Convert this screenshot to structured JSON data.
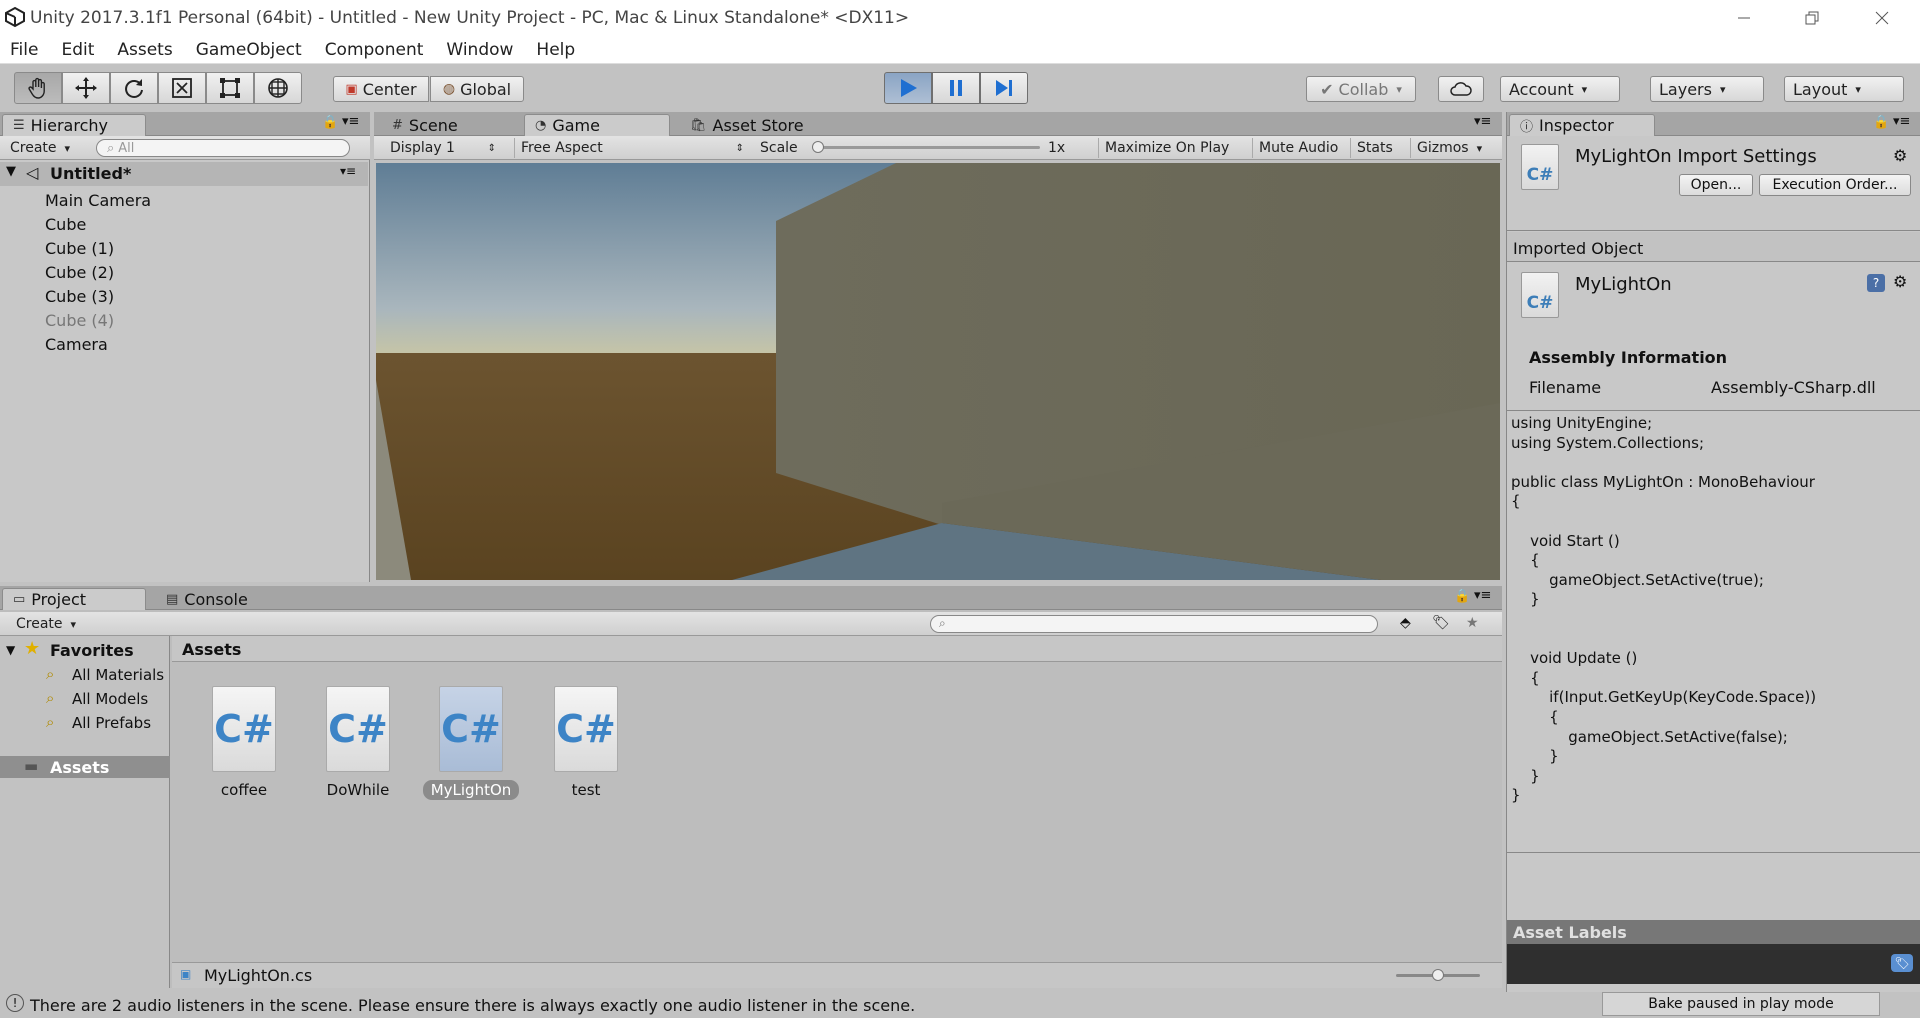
{
  "window": {
    "title": "Unity 2017.3.1f1 Personal (64bit) - Untitled - New Unity Project - PC, Mac & Linux Standalone* <DX11>"
  },
  "menu": [
    "File",
    "Edit",
    "Assets",
    "GameObject",
    "Component",
    "Window",
    "Help"
  ],
  "toolbar": {
    "pivot": "Center",
    "space": "Global",
    "collab": "Collab",
    "account": "Account",
    "layers": "Layers",
    "layout": "Layout"
  },
  "hierarchy": {
    "tab": "Hierarchy",
    "create": "Create",
    "search_placeholder": "All",
    "scene": "Untitled*",
    "items": [
      "Main Camera",
      "Cube",
      "Cube (1)",
      "Cube (2)",
      "Cube (3)",
      "Cube (4)",
      "Camera"
    ]
  },
  "center_tabs": [
    "Scene",
    "Game",
    "Asset Store"
  ],
  "game": {
    "display": "Display 1",
    "aspect": "Free Aspect",
    "scale_label": "Scale",
    "scale_value": "1x",
    "scale_fraction": 0,
    "maximize": "Maximize On Play",
    "mute": "Mute Audio",
    "stats": "Stats",
    "gizmos": "Gizmos"
  },
  "inspector": {
    "tab": "Inspector",
    "title": "MyLightOn Import Settings",
    "open_btn": "Open...",
    "exec_btn": "Execution Order...",
    "imported_object": "Imported Object",
    "object_name": "MyLightOn",
    "assembly_heading": "Assembly Information",
    "filename_label": "Filename",
    "filename_value": "Assembly-CSharp.dll",
    "code": "using UnityEngine;\nusing System.Collections;\n\npublic class MyLightOn : MonoBehaviour\n{\n\n    void Start ()\n    {\n        gameObject.SetActive(true);\n    }\n\n\n    void Update ()\n    {\n        if(Input.GetKeyUp(KeyCode.Space))\n        {\n            gameObject.SetActive(false);\n        }\n    }\n}",
    "asset_labels": "Asset Labels"
  },
  "project": {
    "tabs": [
      "Project",
      "Console"
    ],
    "create": "Create",
    "favorites": "Favorites",
    "favorites_items": [
      "All Materials",
      "All Models",
      "All Prefabs"
    ],
    "assets_root": "Assets",
    "breadcrumb": "Assets",
    "assets": [
      "coffee",
      "DoWhile",
      "MyLightOn",
      "test"
    ],
    "selected_asset": "MyLightOn",
    "selected_file": "MyLightOn.cs",
    "icon_size_fraction": 0.5
  },
  "status": {
    "message": "There are 2 audio listeners in the scene. Please ensure there is always exactly one audio listener in the scene.",
    "bake": "Bake paused in play mode"
  },
  "icon_glyph": "C#",
  "colors": {
    "play_active": "#8aa4c4",
    "selection": "#8b8b8b",
    "csharp": "#3d84c6"
  }
}
